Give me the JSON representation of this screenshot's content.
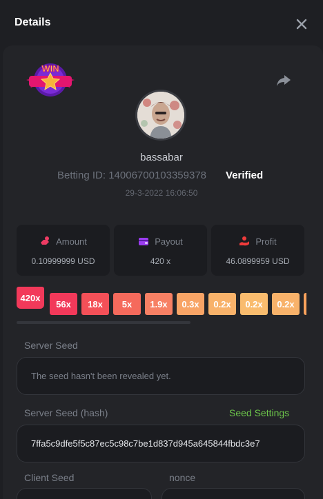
{
  "header": {
    "title": "Details"
  },
  "win_badge_text": "WIN",
  "user": {
    "username": "bassabar",
    "betting_id_label": "Betting ID:",
    "betting_id": "14006700103359378",
    "betting_line": "Betting ID: 14006700103359378",
    "verified": "Verified",
    "date": "29-3-2022 16:06:50"
  },
  "stats": {
    "amount": {
      "label": "Amount",
      "value": "0.10999999 USD",
      "icon": "coin-hand-icon"
    },
    "payout": {
      "label": "Payout",
      "value": "420 x",
      "icon": "wallet-icon"
    },
    "profit": {
      "label": "Profit",
      "value": "46.0899959 USD",
      "icon": "hand-coin-icon"
    }
  },
  "multipliers": [
    "420x",
    "56x",
    "18x",
    "5x",
    "1.9x",
    "0.3x",
    "0.2x",
    "0.2x",
    "0.2x"
  ],
  "colors": {
    "accent_green": "#6cc44a",
    "mult": [
      "#f2395a",
      "#f2395a",
      "#f45058",
      "#f56a5c",
      "#f78064",
      "#f8a466",
      "#f8b26a",
      "#f9bc6e",
      "#f8b26a"
    ]
  },
  "server_seed": {
    "label": "Server Seed",
    "value": "The seed hasn't been revealed yet."
  },
  "server_seed_hash": {
    "label": "Server Seed (hash)",
    "value": "7ffa5c9dfe5f5c87ec5c98c7be1d837d945a645844fbdc3e7",
    "settings_label": "Seed Settings"
  },
  "client_seed": {
    "label": "Client Seed"
  },
  "nonce": {
    "label": "nonce"
  }
}
